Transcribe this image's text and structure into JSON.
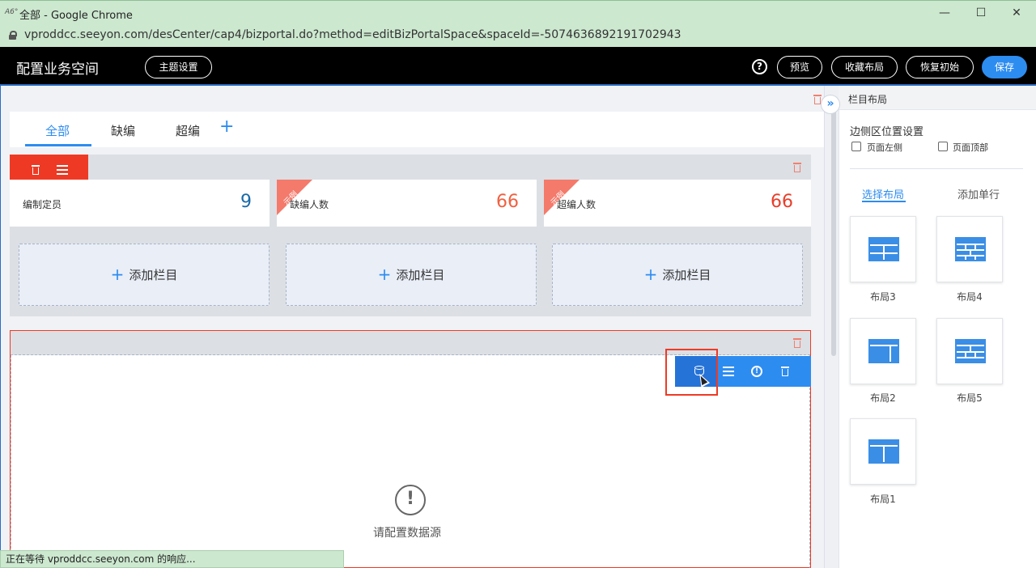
{
  "window": {
    "title": "全部 - Google Chrome",
    "app_icon": "A6°",
    "minimize": "—",
    "maximize": "☐",
    "close": "✕"
  },
  "address": {
    "url": "vproddcc.seeyon.com/desCenter/cap4/bizportal.do?method=editBizPortalSpace&spaceId=-5074636892191702943"
  },
  "header": {
    "title": "配置业务空间",
    "theme_button": "主题设置",
    "help": "?",
    "preview_button": "预览",
    "collect_button": "收藏布局",
    "restore_button": "恢复初始",
    "save_button": "保存"
  },
  "tabs": [
    {
      "label": "全部"
    },
    {
      "label": "缺编"
    },
    {
      "label": "超编"
    }
  ],
  "tab_add": "+",
  "cards": [
    {
      "label": "编制定员",
      "value": "9",
      "value_color": "#1a6aa8",
      "ribbon": ""
    },
    {
      "label": "缺编人数",
      "value": "66",
      "value_color": "#f06040",
      "ribbon": "示例"
    },
    {
      "label": "超编人数",
      "value": "66",
      "value_color": "#e83e2a",
      "ribbon": "示例"
    }
  ],
  "add_column_label": "添加栏目",
  "empty_state": {
    "icon": "!",
    "text": "请配置数据源"
  },
  "status_text": "正在等待 vproddcc.seeyon.com 的响应...",
  "panel": {
    "expand": "»",
    "title": "栏目布局",
    "side_position_title": "边侧区位置设置",
    "option_left": "页面左侧",
    "option_top": "页面顶部",
    "tab_select_layout": "选择布局",
    "tab_add_row": "添加单行",
    "layouts": [
      {
        "label": "布局3"
      },
      {
        "label": "布局4"
      },
      {
        "label": "布局2"
      },
      {
        "label": "布局5"
      },
      {
        "label": "布局1"
      }
    ]
  },
  "colors": {
    "accent": "#2d8cf0",
    "danger": "#ee3a24",
    "chrome_green": "#cce8cf"
  }
}
